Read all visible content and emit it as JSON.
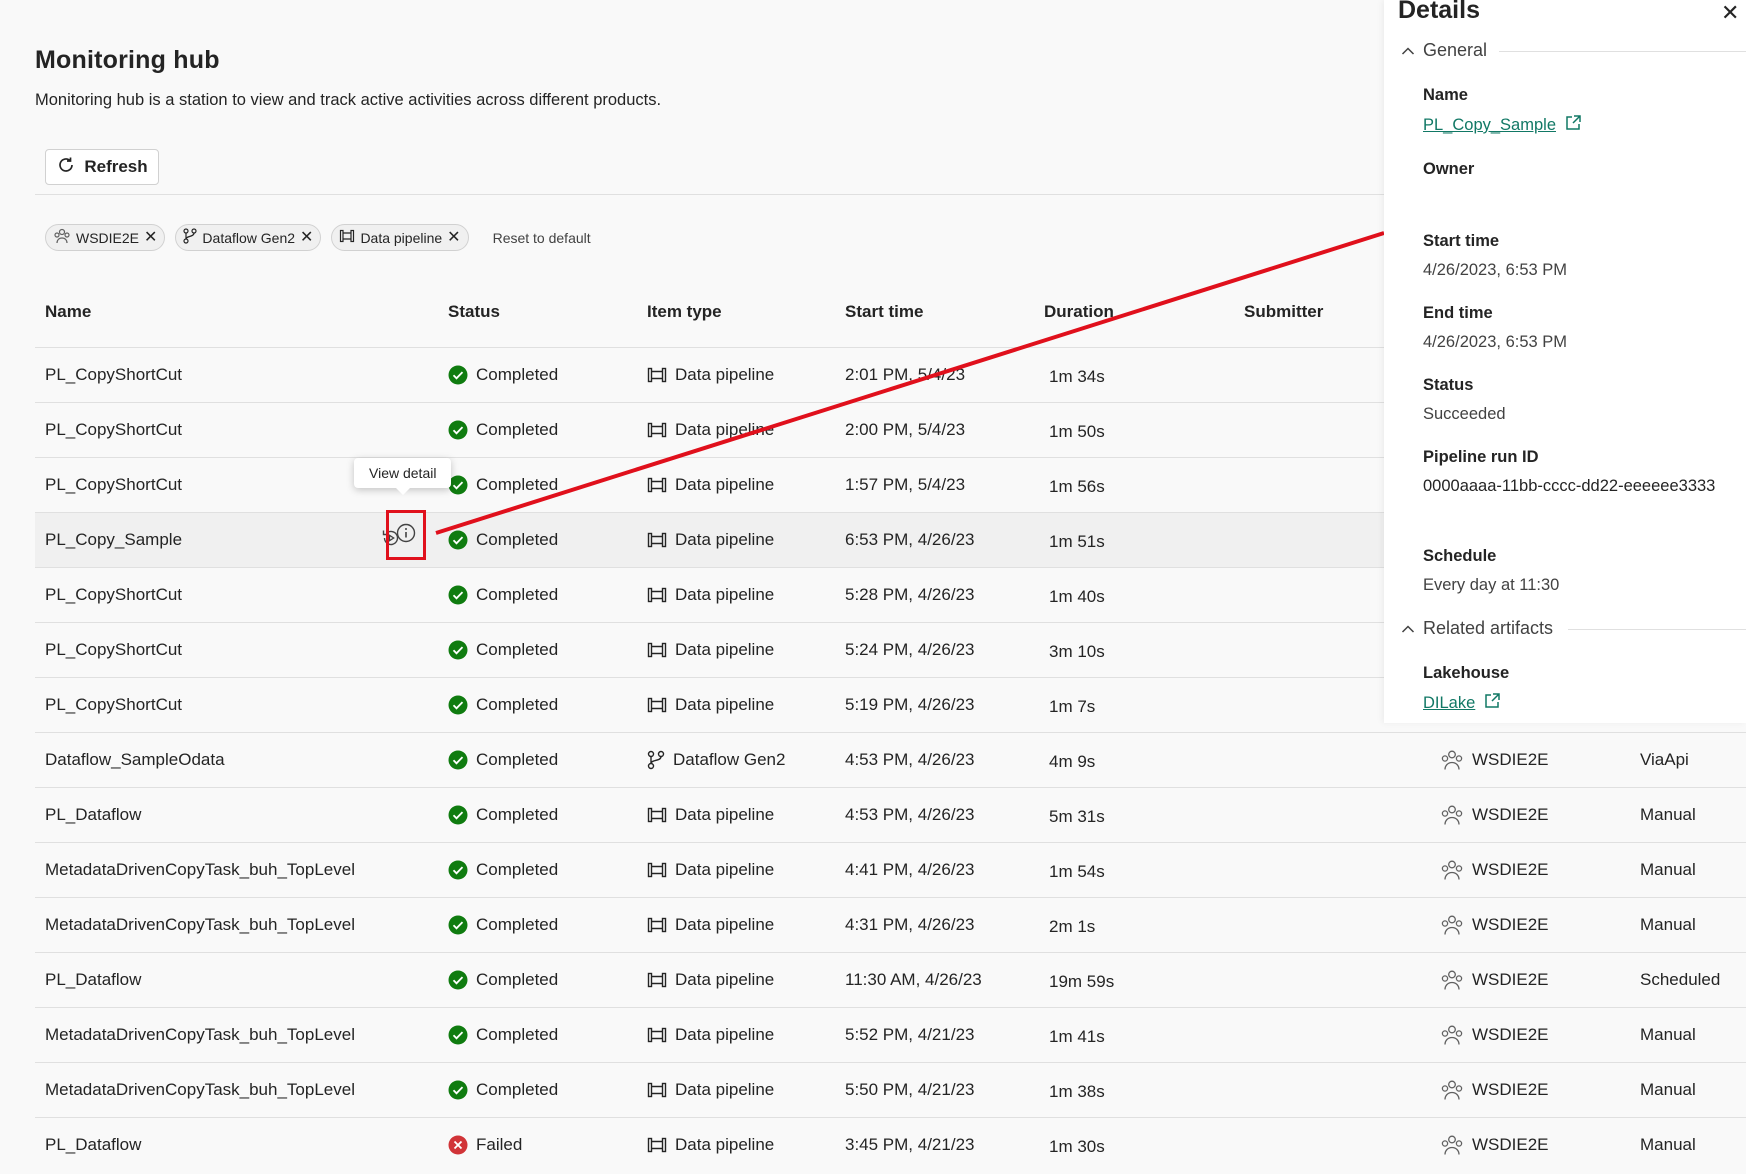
{
  "page": {
    "title": "Monitoring hub",
    "description": "Monitoring hub is a station to view and track active activities across different products."
  },
  "toolbar": {
    "refresh_label": "Refresh"
  },
  "filters": {
    "chips": [
      {
        "label": "WSDIE2E",
        "icon": "workspace-icon"
      },
      {
        "label": "Dataflow Gen2",
        "icon": "dataflow-icon"
      },
      {
        "label": "Data pipeline",
        "icon": "pipeline-icon"
      }
    ],
    "reset_label": "Reset to default"
  },
  "table": {
    "columns": [
      "Name",
      "Status",
      "Item type",
      "Start time",
      "Duration",
      "Submitter"
    ],
    "rows": [
      {
        "name": "PL_CopyShortCut",
        "status": "Completed",
        "type": "Data pipeline",
        "start": "2:01 PM, 5/4/23",
        "duration": "1m 34s",
        "submitter": "",
        "invoke": ""
      },
      {
        "name": "PL_CopyShortCut",
        "status": "Completed",
        "type": "Data pipeline",
        "start": "2:00 PM, 5/4/23",
        "duration": "1m 50s",
        "submitter": "",
        "invoke": ""
      },
      {
        "name": "PL_CopyShortCut",
        "status": "Completed",
        "type": "Data pipeline",
        "start": "1:57 PM, 5/4/23",
        "duration": "1m 56s",
        "submitter": "",
        "invoke": ""
      },
      {
        "name": "PL_Copy_Sample",
        "status": "Completed",
        "type": "Data pipeline",
        "start": "6:53 PM, 4/26/23",
        "duration": "1m 51s",
        "submitter": "",
        "invoke": ""
      },
      {
        "name": "PL_CopyShortCut",
        "status": "Completed",
        "type": "Data pipeline",
        "start": "5:28 PM, 4/26/23",
        "duration": "1m 40s",
        "submitter": "",
        "invoke": ""
      },
      {
        "name": "PL_CopyShortCut",
        "status": "Completed",
        "type": "Data pipeline",
        "start": "5:24 PM, 4/26/23",
        "duration": "3m 10s",
        "submitter": "",
        "invoke": ""
      },
      {
        "name": "PL_CopyShortCut",
        "status": "Completed",
        "type": "Data pipeline",
        "start": "5:19 PM, 4/26/23",
        "duration": "1m 7s",
        "submitter": "",
        "invoke": ""
      },
      {
        "name": "Dataflow_SampleOdata",
        "status": "Completed",
        "type": "Dataflow Gen2",
        "start": "4:53 PM, 4/26/23",
        "duration": "4m 9s",
        "submitter": "WSDIE2E",
        "invoke": "ViaApi"
      },
      {
        "name": "PL_Dataflow",
        "status": "Completed",
        "type": "Data pipeline",
        "start": "4:53 PM, 4/26/23",
        "duration": "5m 31s",
        "submitter": "WSDIE2E",
        "invoke": "Manual"
      },
      {
        "name": "MetadataDrivenCopyTask_buh_TopLevel",
        "status": "Completed",
        "type": "Data pipeline",
        "start": "4:41 PM, 4/26/23",
        "duration": "1m 54s",
        "submitter": "WSDIE2E",
        "invoke": "Manual"
      },
      {
        "name": "MetadataDrivenCopyTask_buh_TopLevel",
        "status": "Completed",
        "type": "Data pipeline",
        "start": "4:31 PM, 4/26/23",
        "duration": "2m 1s",
        "submitter": "WSDIE2E",
        "invoke": "Manual"
      },
      {
        "name": "PL_Dataflow",
        "status": "Completed",
        "type": "Data pipeline",
        "start": "11:30 AM, 4/26/23",
        "duration": "19m 59s",
        "submitter": "WSDIE2E",
        "invoke": "Scheduled"
      },
      {
        "name": "MetadataDrivenCopyTask_buh_TopLevel",
        "status": "Completed",
        "type": "Data pipeline",
        "start": "5:52 PM, 4/21/23",
        "duration": "1m 41s",
        "submitter": "WSDIE2E",
        "invoke": "Manual"
      },
      {
        "name": "MetadataDrivenCopyTask_buh_TopLevel",
        "status": "Completed",
        "type": "Data pipeline",
        "start": "5:50 PM, 4/21/23",
        "duration": "1m 38s",
        "submitter": "WSDIE2E",
        "invoke": "Manual"
      },
      {
        "name": "PL_Dataflow",
        "status": "Failed",
        "type": "Data pipeline",
        "start": "3:45 PM, 4/21/23",
        "duration": "1m 30s",
        "submitter": "WSDIE2E",
        "invoke": "Manual"
      }
    ]
  },
  "tooltip": {
    "text": "View detail"
  },
  "details": {
    "title": "Details",
    "general_label": "General",
    "name_label": "Name",
    "name_value": "PL_Copy_Sample",
    "owner_label": "Owner",
    "start_label": "Start time",
    "start_value": "4/26/2023, 6:53 PM",
    "end_label": "End time",
    "end_value": "4/26/2023, 6:53 PM",
    "status_label": "Status",
    "status_value": "Succeeded",
    "runid_label": "Pipeline run ID",
    "runid_value": "0000aaaa-11bb-cccc-dd22-eeeeee3333",
    "schedule_label": "Schedule",
    "schedule_value": "Every day at 11:30",
    "related_label": "Related artifacts",
    "lakehouse_label": "Lakehouse",
    "lakehouse_value": "DILake"
  },
  "colors": {
    "success": "#107c10",
    "failed": "#d13438",
    "link": "#117865",
    "annotation": "#e0101c"
  }
}
